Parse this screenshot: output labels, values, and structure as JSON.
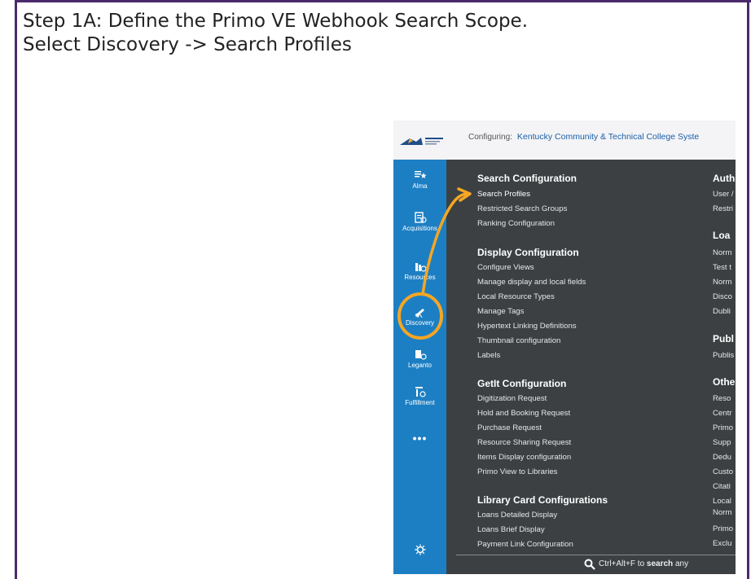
{
  "slide": {
    "title_line1": "Step 1A: Define the Primo VE Webhook Search Scope.",
    "title_line2": "Select Discovery -> Search Profiles"
  },
  "colors": {
    "border": "#4b2a6b",
    "sidebar": "#1d7fc3",
    "menu_bg": "#3c4043",
    "annotation": "#f5a623"
  },
  "header": {
    "configuring_label": "Configuring:",
    "institution": "Kentucky Community & Technical College Syste"
  },
  "sidebar": {
    "items": [
      {
        "label": "Alma",
        "icon": "alma-icon"
      },
      {
        "label": "Acquisitions",
        "icon": "acquisitions-icon"
      },
      {
        "label": "Resources",
        "icon": "resources-icon"
      },
      {
        "label": "Discovery",
        "icon": "discovery-telescope-icon"
      },
      {
        "label": "Leganto",
        "icon": "leganto-icon"
      },
      {
        "label": "Fulfillment",
        "icon": "fulfillment-icon"
      },
      {
        "label": "•••",
        "icon": "more-icon"
      }
    ],
    "settings_icon": "gear-icon"
  },
  "menu": {
    "search_configuration": {
      "title": "Search Configuration",
      "items": [
        "Search Profiles",
        "Restricted Search Groups",
        "Ranking Configuration"
      ]
    },
    "display_configuration": {
      "title": "Display Configuration",
      "items": [
        "Configure Views",
        "Manage display and local fields",
        "Local Resource Types",
        "Manage Tags",
        "Hypertext Linking Definitions",
        "Thumbnail configuration",
        "Labels"
      ]
    },
    "getit_configuration": {
      "title": "GetIt Configuration",
      "items": [
        "Digitization Request",
        "Hold and Booking Request",
        "Purchase Request",
        "Resource Sharing Request",
        "Items Display configuration",
        "Primo View to Libraries"
      ]
    },
    "library_card": {
      "title": "Library Card Configurations",
      "items": [
        "Loans Detailed Display",
        "Loans Brief Display",
        "Payment Link Configuration"
      ]
    },
    "right_column": {
      "auth_title": "Auth",
      "auth_items": [
        "User /",
        "Restri"
      ],
      "load_title": "Loa",
      "load_items": [
        "Norm",
        "Test t",
        "Norm",
        "Disco",
        "Dubli"
      ],
      "pub_title": "Publ",
      "pub_items": [
        "Publis"
      ],
      "other_title": "Othe",
      "other_items": [
        "Reso",
        "Centr",
        "Primo",
        "Supp",
        "Dedu",
        "Custo",
        "Citati",
        "Local",
        "Norm",
        "Primo",
        "Exclu"
      ]
    }
  },
  "search_hint": {
    "shortcut": "Ctrl+Alt+F to",
    "bold": "search",
    "rest": "any"
  }
}
